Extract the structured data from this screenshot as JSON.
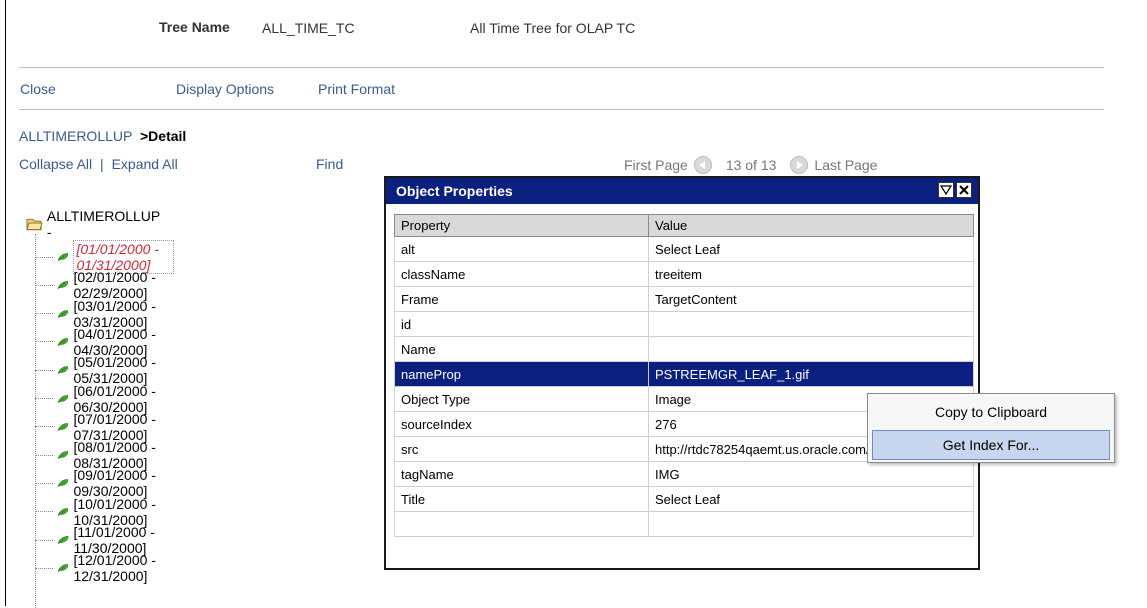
{
  "header": {
    "tree_name_label": "Tree Name",
    "tree_name_value": "ALL_TIME_TC",
    "tree_description": "All Time Tree for OLAP TC"
  },
  "toolbar": {
    "close": "Close",
    "display_options": "Display Options",
    "print_format": "Print Format"
  },
  "breadcrumb": {
    "root": "ALLTIMEROLLUP",
    "separator": ">",
    "current": "Detail"
  },
  "tree_actions": {
    "collapse_all": "Collapse All",
    "separator": "|",
    "expand_all": "Expand All",
    "find": "Find"
  },
  "pager": {
    "first_page": "First Page",
    "position": "13 of 13",
    "last_page": "Last Page"
  },
  "tree": {
    "root_label": "ALLTIMEROLLUP -",
    "leaves": [
      "[01/01/2000 - 01/31/2000]",
      "[02/01/2000 - 02/29/2000]",
      "[03/01/2000 - 03/31/2000]",
      "[04/01/2000 - 04/30/2000]",
      "[05/01/2000 - 05/31/2000]",
      "[06/01/2000 - 06/30/2000]",
      "[07/01/2000 - 07/31/2000]",
      "[08/01/2000 - 08/31/2000]",
      "[09/01/2000 - 09/30/2000]",
      "[10/01/2000 - 10/31/2000]",
      "[11/01/2000 - 11/30/2000]",
      "[12/01/2000 - 12/31/2000]"
    ]
  },
  "object_properties": {
    "title": "Object Properties",
    "columns": {
      "property": "Property",
      "value": "Value"
    },
    "rows": [
      {
        "property": "alt",
        "value": "Select Leaf"
      },
      {
        "property": "className",
        "value": "treeitem"
      },
      {
        "property": "Frame",
        "value": "TargetContent"
      },
      {
        "property": "id",
        "value": ""
      },
      {
        "property": "Name",
        "value": ""
      },
      {
        "property": "nameProp",
        "value": "PSTREEMGR_LEAF_1.gif"
      },
      {
        "property": "Object Type",
        "value": "Image"
      },
      {
        "property": "sourceIndex",
        "value": "276"
      },
      {
        "property": "src",
        "value": "http://rtdc78254qaemt.us.oracle.com/cs..."
      },
      {
        "property": "tagName",
        "value": "IMG"
      },
      {
        "property": "Title",
        "value": "Select Leaf"
      },
      {
        "property": "",
        "value": ""
      }
    ]
  },
  "context_menu": {
    "copy": "Copy to Clipboard",
    "get_index": "Get Index For..."
  },
  "colors": {
    "link": "#3a5a8c",
    "title_bar": "#0b1f7e",
    "selected_leaf": "#cc2a3a",
    "menu_hover": "#c8d6ef"
  }
}
